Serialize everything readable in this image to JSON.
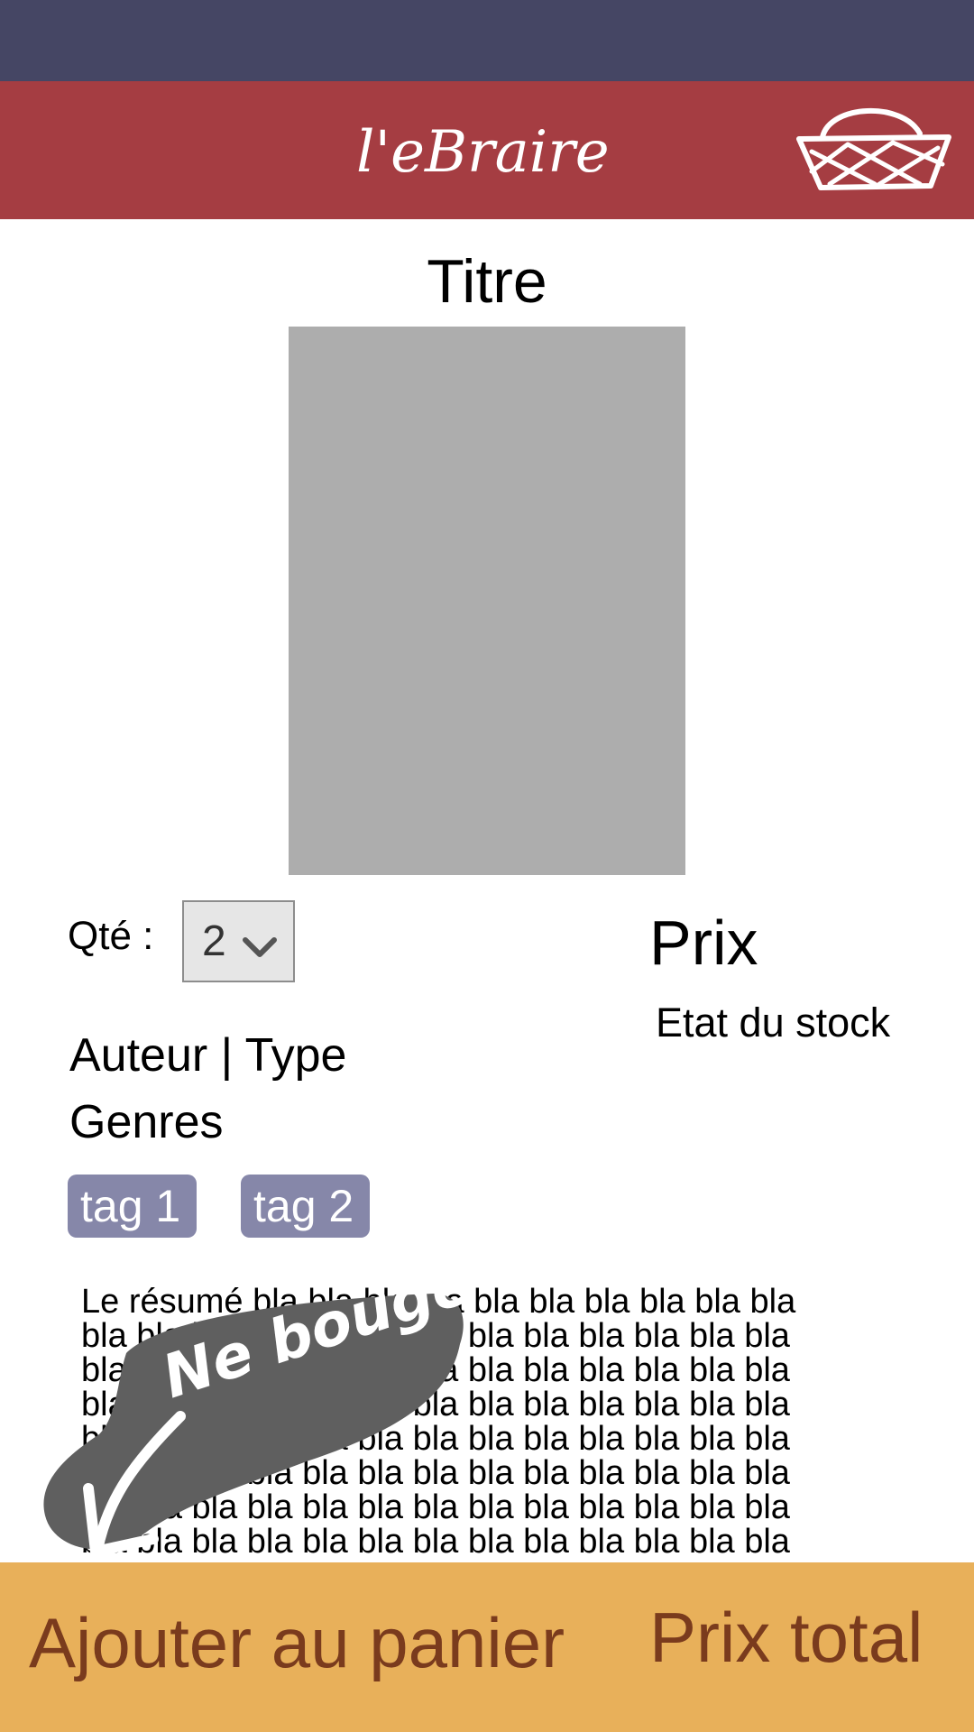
{
  "header": {
    "logo_text": "l'eBraire"
  },
  "product": {
    "title": "Titre",
    "price": "Prix",
    "stock_status": "Etat du stock",
    "author_type": "Auteur | Type",
    "genres": "Genres",
    "tags": [
      "tag 1",
      "tag 2"
    ],
    "summary": "Le résumé bla bla bla bla bla bla bla bla bla bla\nbla bla bla bla bla bla bla bla bla bla bla bla bla\nbla bla bla bla bla bla bla bla bla bla bla bla bla\nbla bla bla bla bla bla bla bla bla bla bla bla bla\nbla bla bla bla bla bla bla bla bla bla bla bla bla\nbla bla bla bla bla bla bla bla bla bla bla bla bla\nbla bla bla bla bla bla bla bla bla bla bla bla bla\nbla bla bla bla bla bla bla bla bla bla bla bla bla"
  },
  "quantity": {
    "label": "Qté :",
    "selected": "2"
  },
  "annotation": {
    "text": "Ne bouge pas"
  },
  "footer": {
    "add_to_cart_label": "Ajouter au panier",
    "total_label": "Prix total"
  },
  "colors": {
    "status_bar": "#454664",
    "header": "#a53d42",
    "footer": "#e8b05a",
    "footer_text": "#7a3b1d",
    "tag": "#8687a9",
    "cover_placeholder": "#adadad"
  }
}
